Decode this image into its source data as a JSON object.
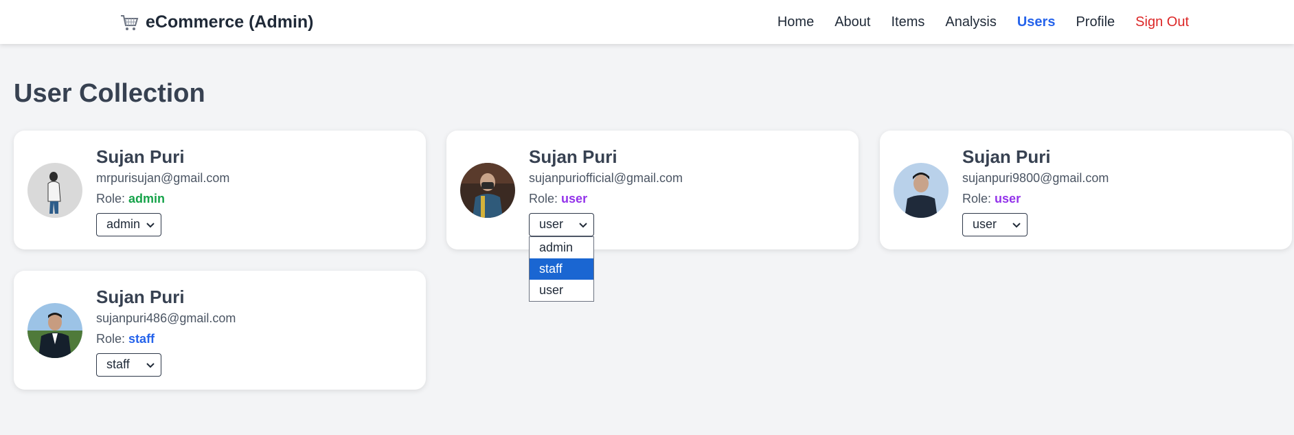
{
  "nav": {
    "brand": "eCommerce (Admin)",
    "brand_icon": "shopping-cart-icon",
    "links": [
      "Home",
      "About",
      "Items",
      "Analysis",
      "Users",
      "Profile",
      "Sign Out"
    ],
    "active": "Users"
  },
  "page_title": "User Collection",
  "role_label": "Role:",
  "colors": {
    "admin": "#16a34a",
    "user": "#9333ea",
    "staff": "#2563eb",
    "signout": "#dc2626",
    "active_nav": "#2563eb"
  },
  "users": [
    {
      "name": "Sujan Puri",
      "email": "mrpurisujan@gmail.com",
      "role": "admin",
      "select_value": "admin"
    },
    {
      "name": "Sujan Puri",
      "email": "sujanpuriofficial@gmail.com",
      "role": "user",
      "select_value": "user"
    },
    {
      "name": "Sujan Puri",
      "email": "sujanpuri9800@gmail.com",
      "role": "user",
      "select_value": "user"
    },
    {
      "name": "Sujan Puri",
      "email": "sujanpuri486@gmail.com",
      "role": "staff",
      "select_value": "staff"
    }
  ],
  "open_dropdown": {
    "options": [
      "admin",
      "staff",
      "user"
    ],
    "highlighted": "staff"
  }
}
